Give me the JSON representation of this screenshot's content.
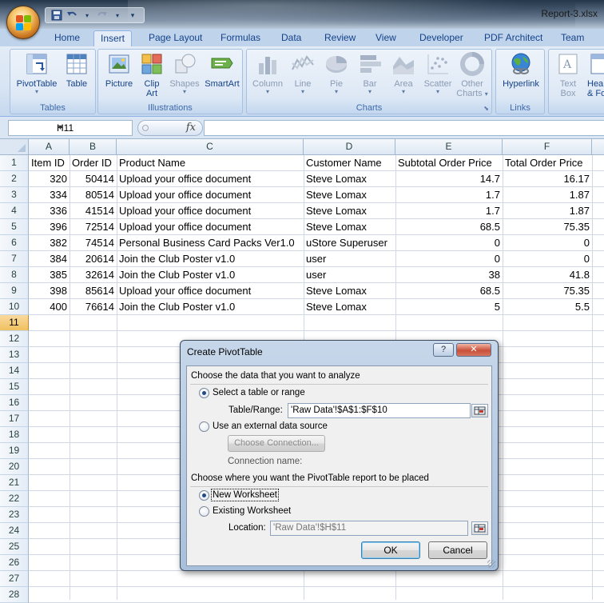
{
  "window": {
    "title": "Report-3.xlsx"
  },
  "qat": {
    "icons": [
      "save-icon",
      "undo-icon",
      "redo-icon",
      "customize-icon"
    ]
  },
  "tabs": [
    "Home",
    "Insert",
    "Page Layout",
    "Formulas",
    "Data",
    "Review",
    "View",
    "Developer",
    "PDF Architect",
    "Team"
  ],
  "active_tab": "Insert",
  "ribbon": {
    "groups": {
      "tables": {
        "label": "Tables",
        "pivot": "PivotTable",
        "table": "Table"
      },
      "illustrations": {
        "label": "Illustrations",
        "picture": "Picture",
        "clip_art_1": "Clip",
        "clip_art_2": "Art",
        "shapes": "Shapes",
        "smartart": "SmartArt"
      },
      "charts": {
        "label": "Charts",
        "column": "Column",
        "line": "Line",
        "pie": "Pie",
        "bar": "Bar",
        "area": "Area",
        "scatter": "Scatter",
        "other_1": "Other",
        "other_2": "Charts"
      },
      "links": {
        "label": "Links",
        "hyperlink": "Hyperlink"
      },
      "text": {
        "textbox_1": "Text",
        "textbox_2": "Box",
        "header_1": "Hea",
        "header_2": "& Fo"
      }
    }
  },
  "formula_bar": {
    "name_box": "H11",
    "fx": "fx",
    "formula": ""
  },
  "sheet": {
    "columns": [
      "A",
      "B",
      "C",
      "D",
      "E",
      "F"
    ],
    "row_numbers": [
      "1",
      "2",
      "3",
      "4",
      "5",
      "6",
      "7",
      "8",
      "9",
      "10",
      "11",
      "12",
      "13",
      "14",
      "15",
      "16",
      "17",
      "18",
      "19",
      "20",
      "21",
      "22",
      "23",
      "24",
      "25",
      "26",
      "27",
      "28"
    ],
    "header": [
      "Item ID",
      "Order ID",
      "Product Name",
      "Customer Name",
      "Subtotal Order Price",
      "Total Order Price"
    ],
    "rows": [
      [
        "320",
        "50414",
        "Upload your office document",
        "Steve Lomax",
        "14.7",
        "16.17"
      ],
      [
        "334",
        "80514",
        "Upload your office document",
        "Steve Lomax",
        "1.7",
        "1.87"
      ],
      [
        "336",
        "41514",
        "Upload your office document",
        "Steve Lomax",
        "1.7",
        "1.87"
      ],
      [
        "396",
        "72514",
        "Upload your office document",
        "Steve Lomax",
        "68.5",
        "75.35"
      ],
      [
        "382",
        "74514",
        "Personal Business Card Packs Ver1.0",
        "uStore Superuser",
        "0",
        "0"
      ],
      [
        "384",
        "20614",
        "Join the Club Poster v1.0",
        "user",
        "0",
        "0"
      ],
      [
        "385",
        "32614",
        "Join the Club Poster v1.0",
        "user",
        "38",
        "41.8"
      ],
      [
        "398",
        "85614",
        "Upload your office document",
        "Steve Lomax",
        "68.5",
        "75.35"
      ],
      [
        "400",
        "76614",
        "Join the Club Poster v1.0",
        "Steve Lomax",
        "5",
        "5.5"
      ]
    ]
  },
  "dialog": {
    "title": "Create PivotTable",
    "help": "?",
    "close": "✕",
    "section1": "Choose the data that you want to analyze",
    "opt_select_table": "Select a table or range",
    "table_range_label": "Table/Range:",
    "table_range_value": "'Raw Data'!$A$1:$F$10",
    "opt_external": "Use an external data source",
    "choose_connection": "Choose Connection...",
    "connection_name_label": "Connection name:",
    "section2": "Choose where you want the PivotTable report to be placed",
    "opt_new_ws": "New Worksheet",
    "opt_existing_ws": "Existing Worksheet",
    "location_label": "Location:",
    "location_value": "'Raw Data'!$H$11",
    "ok": "OK",
    "cancel": "Cancel"
  }
}
